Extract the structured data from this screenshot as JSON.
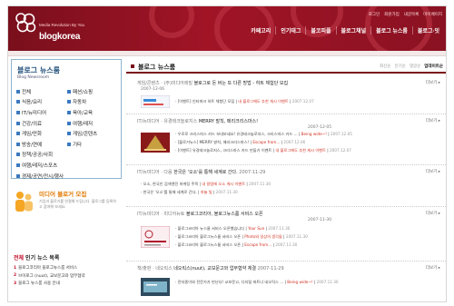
{
  "brand": {
    "tagline": "Media Revolution By You",
    "name": "blogkorea",
    "color": "#7a0f1c"
  },
  "util_links": [
    "로그인",
    "회원가입",
    "내글목록",
    "마이페이지"
  ],
  "nav": [
    "카페고리",
    "인기태그",
    "블코피플",
    "블로그채널",
    "블로그 뉴스룸",
    "블로그·잇"
  ],
  "sidebar": {
    "title": "블로그 뉴스룸",
    "subtitle": "Blog Newsroom",
    "categories": [
      "전체",
      "패션/쇼핑",
      "식음/요리",
      "자동차",
      "IT/뉴미디어",
      "육아/교육",
      "건강/의료",
      "여행/레저",
      "게임/만화",
      "게임/콘텐츠",
      "방송/연예",
      "기타",
      "정책/공공/사회",
      "",
      "여행/레저/스포츠",
      "",
      "경제/공연/전시/행사",
      ""
    ],
    "recruit_title": "미디어 블로거 모집",
    "recruit_desc": "기업과 블로거를 연결해 드립니다. 블로그를 등록하고 참여해 보세요.",
    "popular_title_accent": "전체",
    "popular_title": "인기 뉴스 목록",
    "popular_items": [
      "블로그코리아 블로그뉴스룸 서비스",
      "브이로그 (nuut), 교보문고와 업무협약",
      "블로그 뉴스룸 사용 안내"
    ]
  },
  "main": {
    "title": "블로그 뉴스룸",
    "sort_options": [
      "최신순",
      "인기순",
      "댓글순",
      "업데이트순"
    ],
    "articles": [
      {
        "src": "게임/콘텐츠",
        "company": "(주)미디어레빌",
        "headline": "블로그로 돈 버는 또 다른 방법 - 하트 체험단 모집",
        "date": "2007-12-06",
        "subs": [
          {
            "text": "[이벤트] 인터파크 하트 체험단 모집",
            "red": "내 블로그에도 추천 게시 이벤트",
            "date": "2007.12.07"
          }
        ]
      },
      {
        "src": "IT/뉴미디어",
        "company": "유경테크놀로지스",
        "headline": "MERRY 발칙, 메리크리스마스!",
        "date": "2007-12-05",
        "subs": [
          {
            "text": "우로로 크리스마스 카드 보내보세요! 유경테크놀로지스, 크리스마스 카드 ...",
            "red": "Being wide~!",
            "date": "2007.12.05"
          },
          {
            "text": "[블로거뉴스] MERRY 발칙, 메리크리스마스!",
            "red": "Escape from...",
            "date": "2007.12.06"
          },
          {
            "text": "[이벤트] 유경테크놀로지스, 크리스마스 카드 만들기 이벤트",
            "red": "내 블로그에도 추천 게시 이벤트",
            "date": "2007.12.07"
          }
        ]
      },
      {
        "src": "IT/뉴미디어",
        "company": "다음",
        "headline": "한국은 '오소'를 통해 세계로 간다.",
        "date": "2007-11-29",
        "subs": [
          {
            "text": "오소, 한국인 검색엔진 마케팅 주목",
            "red": "내 칼럼에 오소 게시 이벤트",
            "date": "2007.11.30"
          },
          {
            "text": "한국은 '오소'를 통해 세계로 간다.",
            "red": "하늘 빛",
            "date": "2007.11.30"
          }
        ]
      },
      {
        "src": "IT/뉴미디어",
        "company": "미디어뉴토",
        "headline": "블로그코리아, 블로그뉴스룸 서비스 오픈",
        "date": "2007-11-30",
        "subs": [
          {
            "text": "블로그코리아 뉴스룸 서비스 오픈했습니다",
            "red": "Your Sun",
            "date": "2007.11.30"
          },
          {
            "text": "블로그코리아 블로그뉴스룸 서비스 오픈",
            "red": "Photo와 일상의 생각들",
            "date": "2007.11.30"
          },
          {
            "text": "블로그코리아 블로그뉴스룸 서비스 오픈",
            "red": "Escape from...",
            "date": "2007.11.30"
          }
        ]
      },
      {
        "src": "책/출판",
        "company": "네오릭스",
        "headline": "네오릭스(nuut), 교보문고와 업무협약 체결",
        "date": "2007-11-29",
        "subs": [
          {
            "text": "전자종이와 전문가가 만난다! 교보문고, 디지털 파트너 네오릭스 ...",
            "red": "Being wide~!",
            "date": "2007.11.30"
          }
        ]
      }
    ],
    "more_label": "더보기 ▸"
  }
}
